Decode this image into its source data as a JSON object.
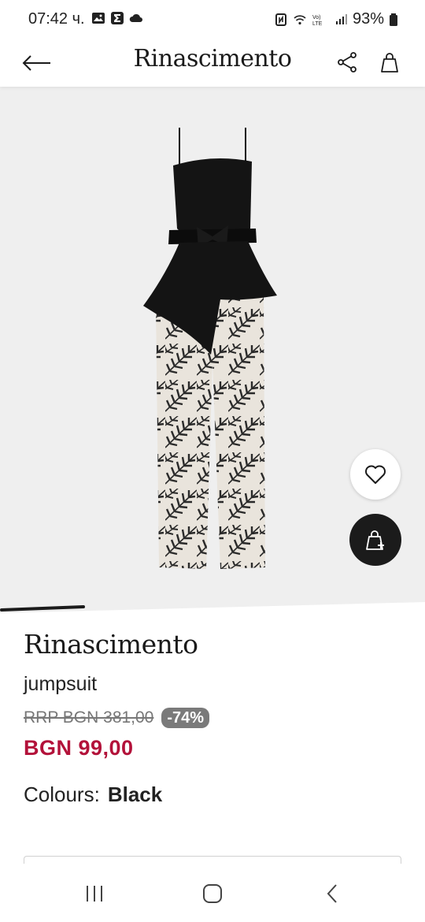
{
  "status_bar": {
    "time": "07:42 ч.",
    "battery": "93%"
  },
  "header": {
    "title": "Rinascimento",
    "back_icon": "arrow-left-icon",
    "share_icon": "share-icon",
    "bag_icon": "shopping-bag-icon"
  },
  "gallery": {
    "image_description_icon": "jumpsuit-photo",
    "wishlist_icon": "heart-icon",
    "add_to_bag_icon": "add-to-bag-icon",
    "slide_progress": 0.2
  },
  "product": {
    "brand": "Rinascimento",
    "name": "jumpsuit",
    "rrp_price": "RRP BGN 381,00",
    "discount": "-74%",
    "price": "BGN 99,00",
    "colour_label": "Colours:",
    "colour_value": "Black"
  },
  "colors": {
    "sale_price": "#b3123a",
    "discount_badge": "#7a7a7a",
    "add_button": "#1b1b1b",
    "gallery_bg": "#efefef"
  },
  "nav_bar": {
    "recents_icon": "recents-icon",
    "home_icon": "home-icon",
    "back_icon": "back-chevron-icon"
  }
}
